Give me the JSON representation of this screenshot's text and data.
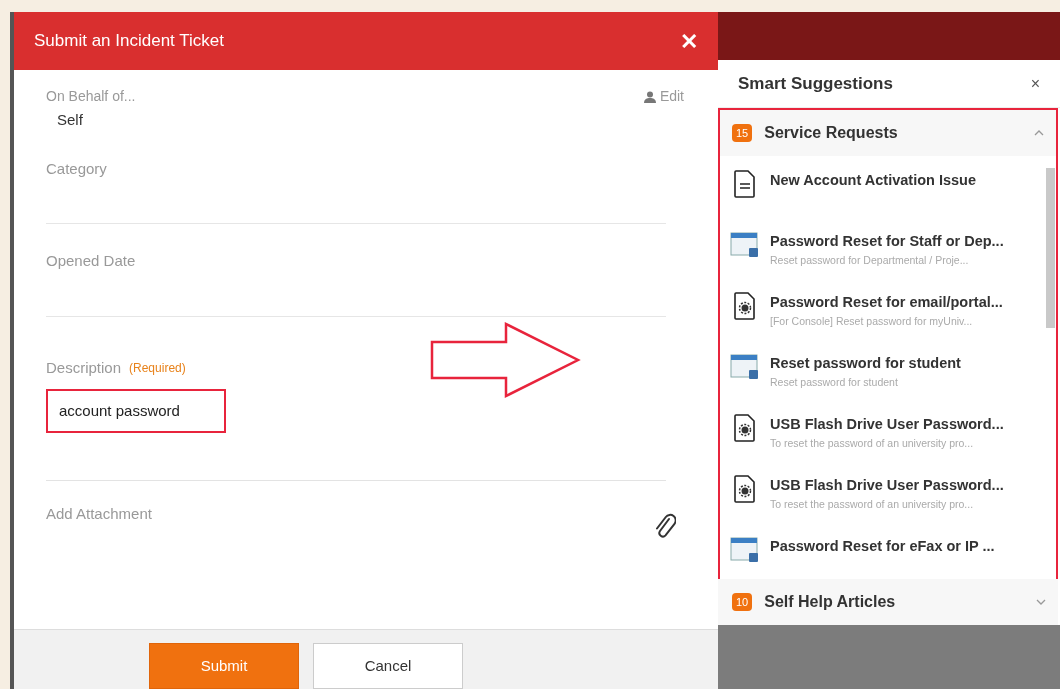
{
  "dialog": {
    "title": "Submit an Incident Ticket",
    "close": "✕",
    "on_behalf": {
      "label": "On Behalf of...",
      "value": "Self",
      "edit": "Edit"
    },
    "fields": [
      {
        "label": "Category"
      },
      {
        "label": "Opened Date"
      }
    ],
    "description": {
      "label": "Description",
      "required": "(Required)",
      "value": "account password"
    },
    "attachment": {
      "label": "Add Attachment"
    },
    "buttons": [
      {
        "label": "Submit",
        "kind": "primary"
      },
      {
        "label": "Cancel",
        "kind": "secondary"
      }
    ]
  },
  "suggestions": {
    "title": "Smart Suggestions",
    "close": "×",
    "sections": [
      {
        "count": "15",
        "title": "Service Requests",
        "expanded": true,
        "items": [
          {
            "kind": "document",
            "title": "New Account Activation Issue"
          },
          {
            "kind": "window",
            "title": "Password Reset for Staff or Dep...",
            "subtitle": "Reset password for Departmental / Proje..."
          },
          {
            "kind": "gear",
            "title": "Password Reset for email/portal...",
            "subtitle": "[For Console] Reset password for myUniv..."
          },
          {
            "kind": "window",
            "title": "Reset password for student",
            "subtitle": "Reset password for student"
          },
          {
            "kind": "gear",
            "title": "USB Flash Drive User Password...",
            "subtitle": "To reset the password of an university pro..."
          },
          {
            "kind": "gear",
            "title": "USB Flash Drive User Password...",
            "subtitle": "To reset the password of an university pro..."
          },
          {
            "kind": "window",
            "title": "Password Reset for eFax or IP ..."
          }
        ]
      },
      {
        "count": "10",
        "title": "Self Help Articles",
        "expanded": false
      }
    ]
  }
}
